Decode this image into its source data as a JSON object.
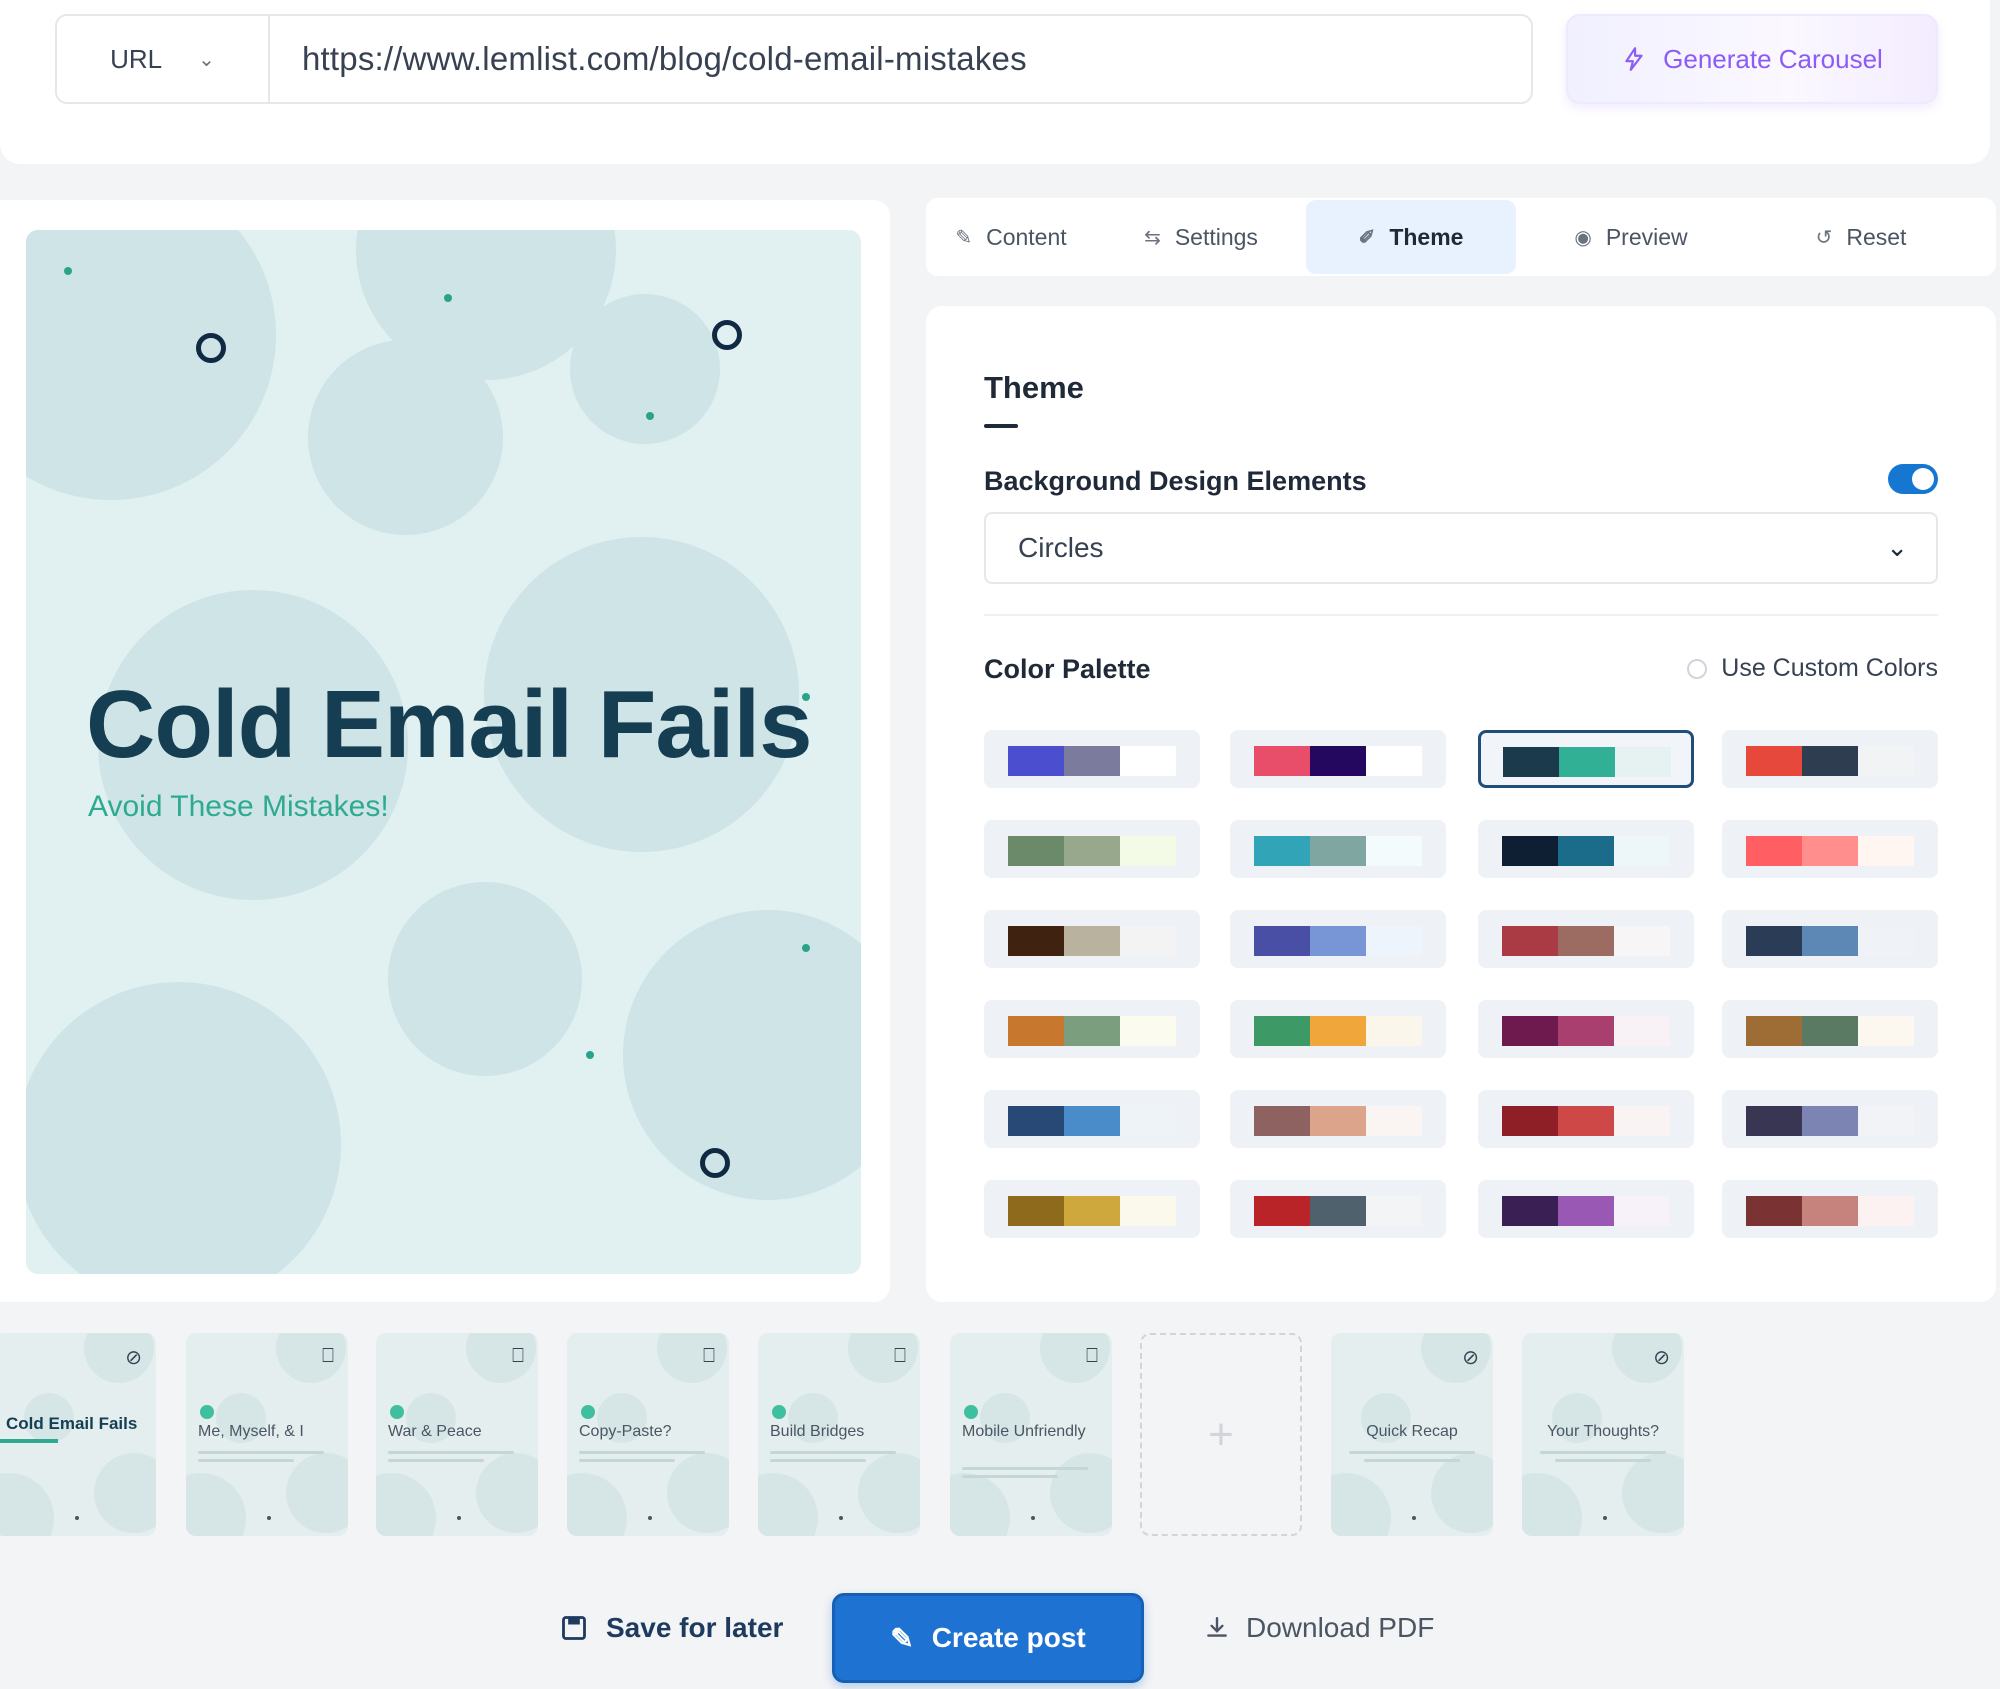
{
  "source": {
    "type_label": "URL",
    "url_value": "https://www.lemlist.com/blog/cold-email-mistakes",
    "generate_label": "Generate Carousel"
  },
  "preview": {
    "title": "Cold Email Fails",
    "subtitle": "Avoid These Mistakes!"
  },
  "tabs": [
    {
      "label": "Content",
      "icon": "pencil-icon"
    },
    {
      "label": "Settings",
      "icon": "sliders-icon"
    },
    {
      "label": "Theme",
      "icon": "brush-icon",
      "active": true
    },
    {
      "label": "Preview",
      "icon": "eye-icon"
    },
    {
      "label": "Reset",
      "icon": "reset-icon"
    }
  ],
  "theme": {
    "heading": "Theme",
    "bg_elements_label": "Background Design Elements",
    "bg_elements_enabled": true,
    "bg_elements_value": "Circles",
    "palette_label": "Color Palette",
    "custom_colors_label": "Use Custom Colors",
    "custom_colors_checked": false,
    "palettes": [
      [
        "#4b4fcf",
        "#7b7b9e",
        "#ffffff"
      ],
      [
        "#e84d6a",
        "#24075e",
        "#ffffff"
      ],
      [
        "#1b3a4b",
        "#31b096",
        "#e6f2f2"
      ],
      [
        "#e6493b",
        "#2e3e50",
        "#f2f3f5"
      ],
      [
        "#6b8a6a",
        "#97a88c",
        "#f3fbe6"
      ],
      [
        "#32a4b8",
        "#7fa6a0",
        "#f4fbfc"
      ],
      [
        "#0e1f33",
        "#1b6b8a",
        "#edf7fa"
      ],
      [
        "#ff5f63",
        "#ff8e8c",
        "#fff6f2"
      ],
      [
        "#3f2210",
        "#b8b29e",
        "#f3f3f3"
      ],
      [
        "#4a4fa6",
        "#7896d6",
        "#eef4fb"
      ],
      [
        "#aa3b45",
        "#9c6b62",
        "#f8f5f6"
      ],
      [
        "#2a3c56",
        "#5d87b5",
        "#eff2f6"
      ],
      [
        "#c8772e",
        "#7a9e7e",
        "#fcfbef"
      ],
      [
        "#3d9a66",
        "#f0a63a",
        "#faf6ec"
      ],
      [
        "#6e1a4e",
        "#a93f6e",
        "#f8f1f5"
      ],
      [
        "#9e6d36",
        "#5b7a64",
        "#fcf7ef"
      ],
      [
        "#284876",
        "#4a8cca",
        "#eef3f8"
      ],
      [
        "#8f6262",
        "#dca48a",
        "#faf4f2"
      ],
      [
        "#8e1f26",
        "#cf4848",
        "#faf3f3"
      ],
      [
        "#393653",
        "#7b84b3",
        "#f2f3f7"
      ],
      [
        "#8e6a1c",
        "#cea83c",
        "#fbf9ec"
      ],
      [
        "#b82428",
        "#4f616c",
        "#f3f4f6"
      ],
      [
        "#3a1f55",
        "#9a58b5",
        "#f7f1f9"
      ],
      [
        "#7a3232",
        "#c6827c",
        "#fbf2f1"
      ]
    ],
    "selected_palette": 2
  },
  "thumbnails": [
    {
      "title": "Cold Email Fails",
      "icon": "eye-off-icon"
    },
    {
      "title": "Me, Myself, & I",
      "icon": "trash-icon"
    },
    {
      "title": "War & Peace",
      "icon": "trash-icon"
    },
    {
      "title": "Copy-Paste?",
      "icon": "trash-icon"
    },
    {
      "title": "Build Bridges",
      "icon": "trash-icon"
    },
    {
      "title": "Mobile Unfriendly",
      "icon": "trash-icon"
    },
    {
      "title": "Quick Recap",
      "icon": "eye-off-icon"
    },
    {
      "title": "Your Thoughts?",
      "icon": "eye-off-icon"
    }
  ],
  "add_slide_label": "+",
  "actions": {
    "save_label": "Save for later",
    "create_label": "Create post",
    "download_label": "Download PDF"
  }
}
